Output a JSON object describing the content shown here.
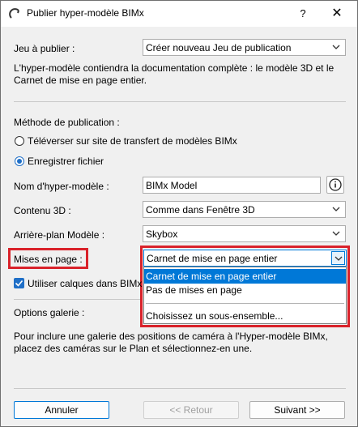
{
  "window": {
    "title": "Publier hyper-modèle BIMx",
    "help": "?",
    "close": "✕"
  },
  "set": {
    "label": "Jeu à publier :",
    "value": "Créer nouveau Jeu de publication",
    "desc_line1": "L'hyper-modèle contiendra la documentation complète : le modèle 3D et le",
    "desc_line2": "Carnet de mise en page entier."
  },
  "method": {
    "label": "Méthode de publication :",
    "opt1": "Téléverser sur site de transfert de modèles BIMx",
    "opt2": "Enregistrer fichier"
  },
  "model_name": {
    "label": "Nom d'hyper-modèle :",
    "value": "BIMx Model"
  },
  "content3d": {
    "label": "Contenu 3D :",
    "value": "Comme dans Fenêtre 3D"
  },
  "background": {
    "label": "Arrière-plan Modèle :",
    "value": "Skybox"
  },
  "layouts": {
    "label": "Mises en page :",
    "value": "Carnet de mise en page entier",
    "options": [
      "Carnet de mise en page entier",
      "Pas de mises en page",
      "Choisissez un sous-ensemble..."
    ]
  },
  "layers": {
    "label": "Utiliser calques dans BIMx"
  },
  "gallery": {
    "label": "Options galerie :",
    "desc_line1": "Pour inclure une galerie des positions de caméra à l'Hyper-modèle BIMx,",
    "desc_line2": "placez des caméras sur le Plan et sélectionnez-en une."
  },
  "buttons": {
    "cancel": "Annuler",
    "back": "<< Retour",
    "next": "Suivant >>"
  },
  "colors": {
    "accent": "#0078d7",
    "highlight": "#d9222a",
    "checkbox": "#1f6fc7"
  },
  "icons": {
    "info": "info-icon",
    "chevron": "chevron-down-icon"
  }
}
